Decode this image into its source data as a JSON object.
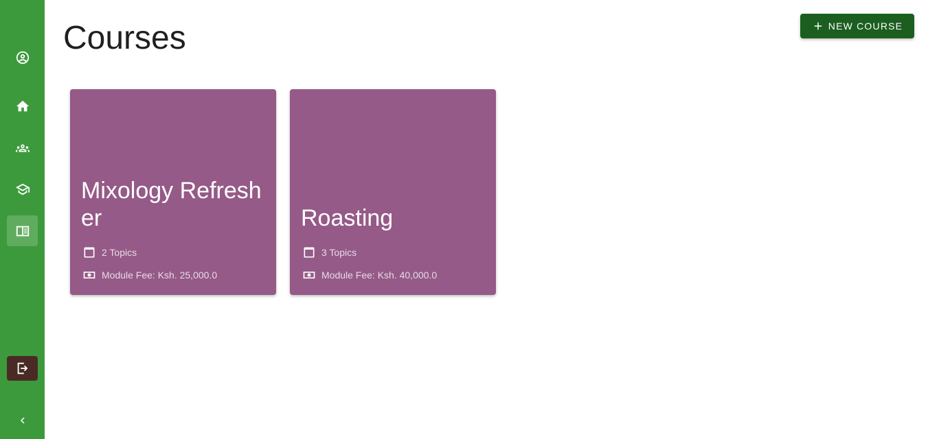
{
  "sidebar": {
    "items": [
      {
        "name": "account-circle-icon"
      },
      {
        "name": "home-icon"
      },
      {
        "name": "groups-icon"
      },
      {
        "name": "school-icon"
      },
      {
        "name": "courses-icon"
      }
    ],
    "logout_icon": "logout-icon",
    "collapse_icon": "chevron-left-icon"
  },
  "header": {
    "title": "Courses",
    "new_button_label": "New Course"
  },
  "courses": [
    {
      "title": "Mixology Refresher",
      "topics": "2 Topics",
      "fee": "Module Fee: Ksh. 25,000.0"
    },
    {
      "title": "Roasting",
      "topics": "3 Topics",
      "fee": "Module Fee: Ksh. 40,000.0"
    }
  ],
  "colors": {
    "sidebar": "#3c9a3c",
    "primary_button": "#1b5e20",
    "card": "#955a88",
    "logout": "#4a2a24"
  }
}
